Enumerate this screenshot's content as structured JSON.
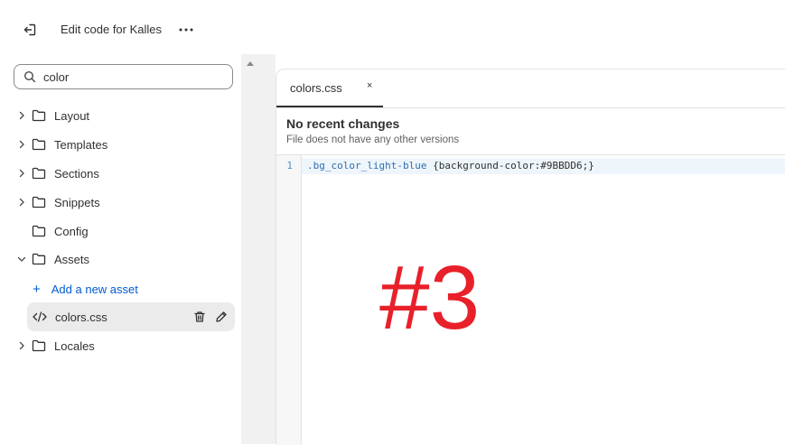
{
  "header": {
    "title": "Edit code for Kalles"
  },
  "sidebar": {
    "search": {
      "value": "color",
      "placeholder": ""
    },
    "items": [
      {
        "label": "Layout",
        "expanded": false
      },
      {
        "label": "Templates",
        "expanded": false
      },
      {
        "label": "Sections",
        "expanded": false
      },
      {
        "label": "Snippets",
        "expanded": false
      },
      {
        "label": "Config",
        "expanded": false
      },
      {
        "label": "Assets",
        "expanded": true
      },
      {
        "label": "Locales",
        "expanded": false
      }
    ],
    "add_asset_label": "Add a new asset",
    "selected_file": "colors.css"
  },
  "editor": {
    "tab_label": "colors.css",
    "tab_close": "×",
    "info_title": "No recent changes",
    "info_subtitle": "File does not have any other versions",
    "line_number": "1",
    "code_selector": ".bg_color_light-blue",
    "code_body": " {background-color:#9BBDD6;}"
  },
  "annotation": "#3",
  "colors": {
    "accent_link": "#005bd3",
    "annotation_red": "#e8202a",
    "selected_row": "#ebebeb"
  }
}
